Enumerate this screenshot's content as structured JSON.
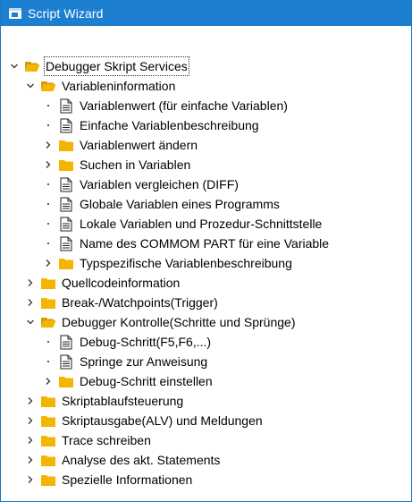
{
  "window": {
    "title": "Script Wizard",
    "icon": "script-wizard-icon",
    "titlebar_color": "#1d7fd0"
  },
  "tree": {
    "root": {
      "label": "Debugger Skript Services",
      "expanded": true,
      "selected": true
    },
    "variableninformation": {
      "label": "Variableninformation",
      "expanded": true,
      "items": [
        {
          "label": "Variablenwert (für einfache Variablen)",
          "type": "document"
        },
        {
          "label": "Einfache Variablenbeschreibung",
          "type": "document"
        },
        {
          "label": "Variablenwert ändern",
          "type": "folder"
        },
        {
          "label": "Suchen in Variablen",
          "type": "folder"
        },
        {
          "label": "Variablen vergleichen (DIFF)",
          "type": "document"
        },
        {
          "label": "Globale Variablen eines Programms",
          "type": "document"
        },
        {
          "label": "Lokale Variablen und Prozedur-Schnittstelle",
          "type": "document"
        },
        {
          "label": "Name des COMMOM PART für eine Variable",
          "type": "document"
        },
        {
          "label": "Typspezifische Variablenbeschreibung",
          "type": "folder"
        }
      ]
    },
    "quellcodeinformation": {
      "label": "Quellcodeinformation"
    },
    "breakpoints": {
      "label": "Break-/Watchpoints(Trigger)"
    },
    "debugger_kontrolle": {
      "label": "Debugger Kontrolle(Schritte und Sprünge)",
      "expanded": true,
      "items": [
        {
          "label": "Debug-Schritt(F5,F6,...)",
          "type": "document"
        },
        {
          "label": "Springe zur Anweisung",
          "type": "document"
        },
        {
          "label": "Debug-Schritt einstellen",
          "type": "folder"
        }
      ]
    },
    "more": [
      {
        "label": "Skriptablaufsteuerung"
      },
      {
        "label": "Skriptausgabe(ALV) und Meldungen"
      },
      {
        "label": "Trace schreiben"
      },
      {
        "label": "Analyse des akt. Statements"
      },
      {
        "label": "Spezielle Informationen"
      }
    ]
  },
  "colors": {
    "folder": "#f5b400",
    "folder_dark": "#d99a00",
    "accent": "#1d7fd0"
  }
}
